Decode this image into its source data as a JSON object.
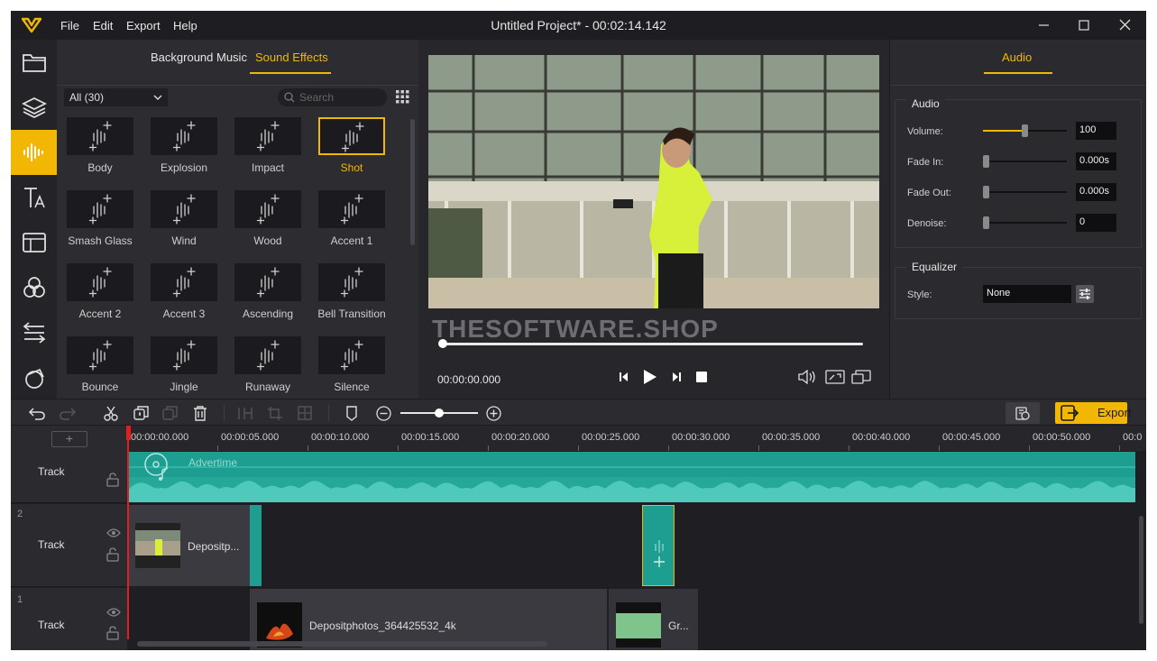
{
  "app": {
    "title": "Untitled Project* - 00:02:14.142",
    "menu": [
      "File",
      "Edit",
      "Export",
      "Help"
    ],
    "accent": "#f2b705"
  },
  "sidebar": {
    "items": [
      {
        "icon": "folder-icon"
      },
      {
        "icon": "layers-icon"
      },
      {
        "icon": "audio-wave-icon",
        "active": true
      },
      {
        "icon": "text-icon"
      },
      {
        "icon": "template-icon"
      },
      {
        "icon": "filters-icon"
      },
      {
        "icon": "transitions-icon"
      },
      {
        "icon": "overlay-icon"
      }
    ]
  },
  "media": {
    "tabs": [
      "Background Music",
      "Sound Effects"
    ],
    "active_tab": "Sound Effects",
    "filter": "All (30)",
    "search_placeholder": "Search",
    "items": [
      "Body",
      "Explosion",
      "Impact",
      "Shot",
      "Smash Glass",
      "Wind",
      "Wood",
      "Accent 1",
      "Accent 2",
      "Accent 3",
      "Ascending",
      "Bell Transition",
      "Bounce",
      "Jingle",
      "Runaway",
      "Silence"
    ],
    "selected": "Shot"
  },
  "preview": {
    "watermark": "THESOFTWARE.SHOP",
    "timecode": "00:00:00.000",
    "progress": 0.0
  },
  "audio_panel": {
    "tab": "Audio",
    "section_audio": "Audio",
    "volume_label": "Volume:",
    "volume_value": "100",
    "volume_level": 0.5,
    "fade_in_label": "Fade In:",
    "fade_in_value": "0.000s",
    "fade_out_label": "Fade Out:",
    "fade_out_value": "0.000s",
    "denoise_label": "Denoise:",
    "denoise_value": "0",
    "section_equalizer": "Equalizer",
    "style_label": "Style:",
    "style_value": "None"
  },
  "toolbar": {
    "export_label": "Export",
    "zoom_level": 0.5
  },
  "timeline": {
    "ticks": [
      "00:00:00.000",
      "00:00:05.000",
      "00:00:10.000",
      "00:00:15.000",
      "00:00:20.000",
      "00:00:25.000",
      "00:00:30.000",
      "00:00:35.000",
      "00:00:40.000",
      "00:00:45.000",
      "00:00:50.000",
      "00:0"
    ],
    "audio_track_label": "Track",
    "audio_clip": "Advertime",
    "track2_label": "Track",
    "track2_num": "2",
    "track2_clip": "Depositp...",
    "track1_label": "Track",
    "track1_num": "1",
    "track1_clip_a": "Depositphotos_364425532_4k",
    "track1_clip_b": "Gr..."
  }
}
